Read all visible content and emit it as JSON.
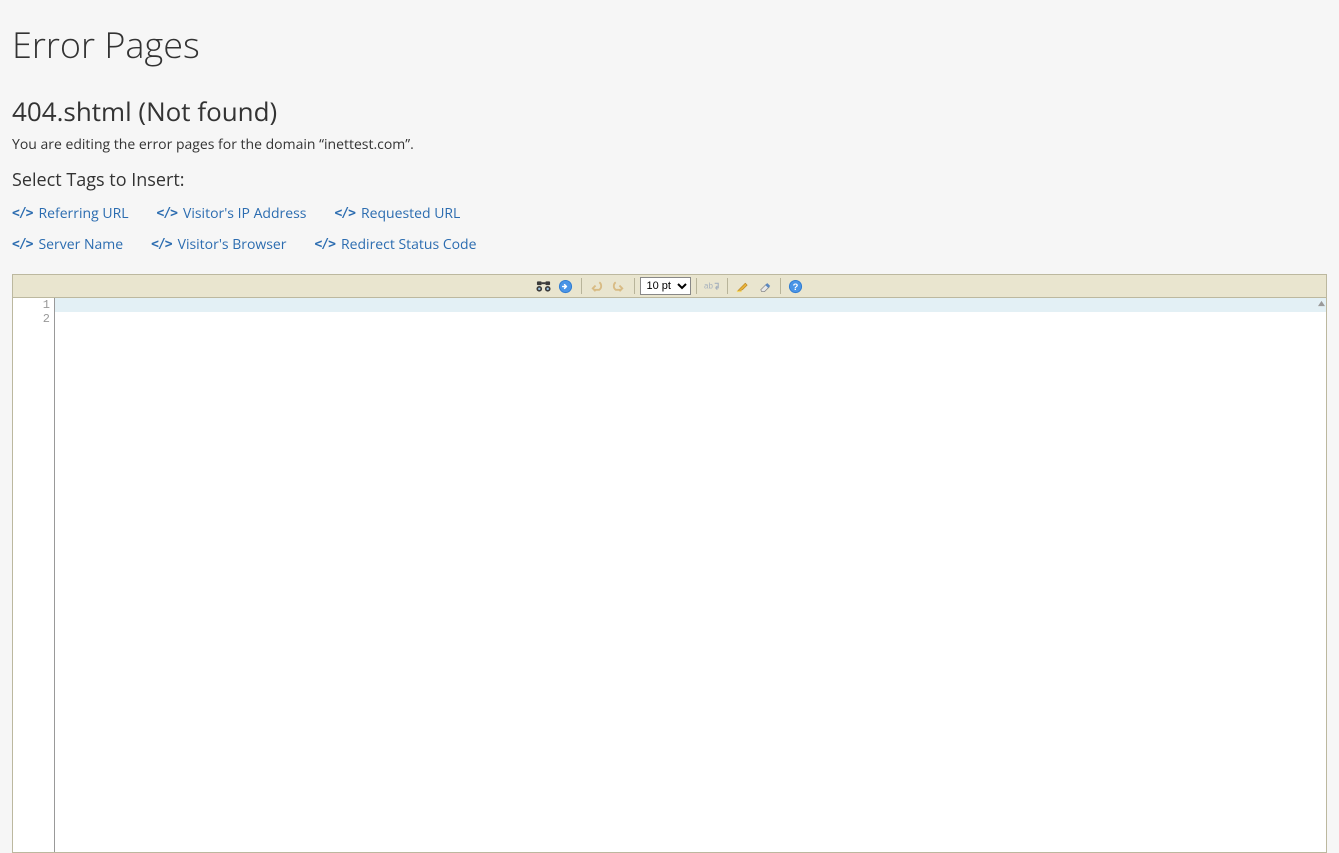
{
  "header": {
    "title": "Error Pages",
    "subtitle": "404.shtml (Not found)",
    "description": "You are editing the error pages for the domain “inettest.com”.",
    "section_title": "Select Tags to Insert:"
  },
  "tags": {
    "row1": [
      {
        "label": "Referring URL"
      },
      {
        "label": "Visitor's IP Address"
      },
      {
        "label": "Requested URL"
      }
    ],
    "row2": [
      {
        "label": "Server Name"
      },
      {
        "label": "Visitor's Browser"
      },
      {
        "label": "Redirect Status Code"
      }
    ]
  },
  "toolbar": {
    "font_size_value": "10 pt"
  },
  "editor": {
    "line_numbers": [
      "1",
      "2"
    ],
    "active_line_index": 0,
    "lines": [
      "",
      ""
    ]
  }
}
